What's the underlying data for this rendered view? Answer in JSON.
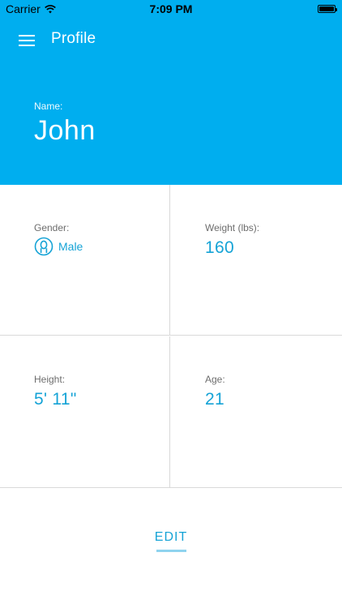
{
  "status_bar": {
    "carrier": "Carrier",
    "time": "7:09 PM",
    "battery_level": 1.0
  },
  "header": {
    "title": "Profile",
    "menu_icon": "hamburger-menu-icon",
    "name_label": "Name:",
    "name_value": "John"
  },
  "fields": {
    "gender": {
      "label": "Gender:",
      "value": "Male",
      "icon": "person-icon"
    },
    "weight": {
      "label": "Weight (lbs):",
      "value": "160"
    },
    "height": {
      "label": "Height:",
      "value": "5' 11\""
    },
    "age": {
      "label": "Age:",
      "value": "21"
    }
  },
  "actions": {
    "edit_label": "EDIT"
  },
  "colors": {
    "primary": "#00aeef",
    "value_text": "#15a3d6",
    "label_text": "#6d6d6d",
    "divider": "#d9d9d9",
    "edit_underline": "#8fd3ef"
  }
}
